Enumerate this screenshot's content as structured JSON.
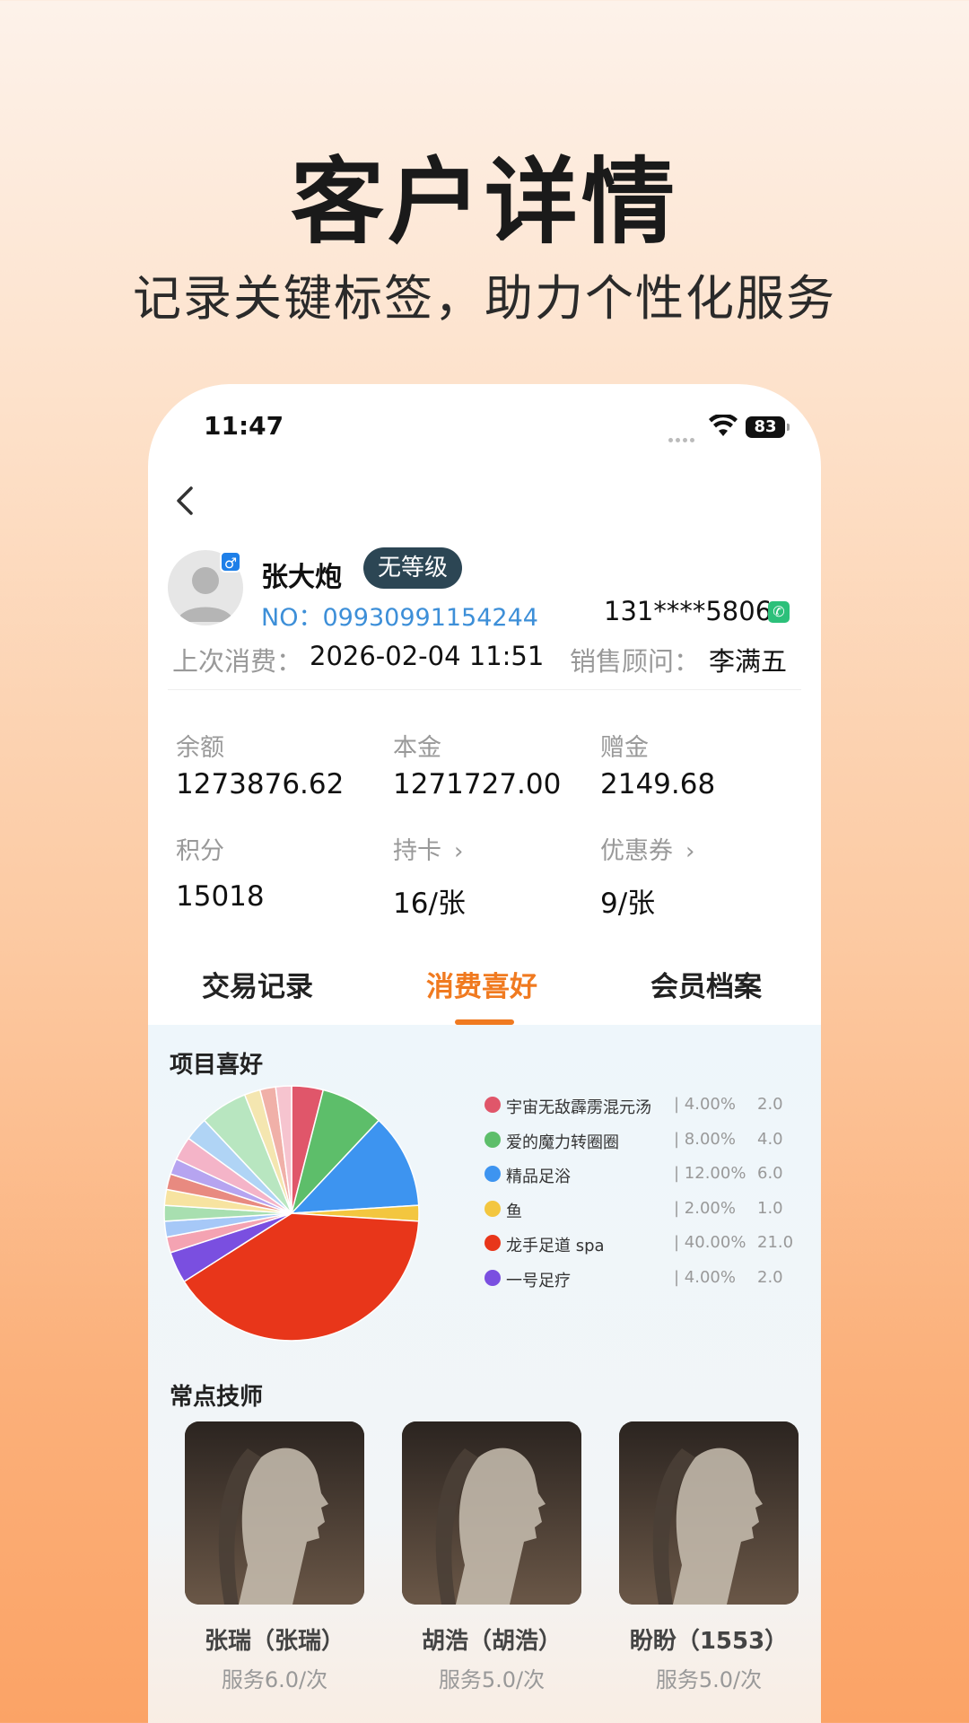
{
  "promo": {
    "title": "客户详情",
    "subtitle": "记录关键标签，助力个性化服务"
  },
  "status_bar": {
    "time": "11:47",
    "battery": "83"
  },
  "customer": {
    "name": "张大炮",
    "level": "无等级",
    "no": "NO：09930991154244",
    "phone": "131****5806",
    "last_consume_label": "上次消费：",
    "last_consume_value": "2026-02-04 11:51",
    "advisor_label": "销售顾问：",
    "advisor_value": "李满五"
  },
  "stats": [
    {
      "label": "余额",
      "value": "1273876.62"
    },
    {
      "label": "本金",
      "value": "1271727.00"
    },
    {
      "label": "赠金",
      "value": "2149.68"
    },
    {
      "label": "积分",
      "value": "15018"
    },
    {
      "label": "持卡",
      "value": "16/张"
    },
    {
      "label": "优惠券",
      "value": "9/张"
    }
  ],
  "tabs": [
    {
      "label": "交易记录"
    },
    {
      "label": "消费喜好"
    },
    {
      "label": "会员档案"
    }
  ],
  "preferences": {
    "title": "项目喜好",
    "technicians_title": "常点技师"
  },
  "chart_data": {
    "type": "pie",
    "title": "项目喜好",
    "legend_position": "right",
    "slices": [
      {
        "name": "宇宙无敌霹雳混元汤",
        "percent": 4.0,
        "value": 2.0,
        "color": "#e0566a"
      },
      {
        "name": "爱的魔力转圈圈",
        "percent": 8.0,
        "value": 4.0,
        "color": "#5dbe6a"
      },
      {
        "name": "精品足浴",
        "percent": 12.0,
        "value": 6.0,
        "color": "#3d94f0"
      },
      {
        "name": "鱼",
        "percent": 2.0,
        "value": 1.0,
        "color": "#f3c63f"
      },
      {
        "name": "龙手足道 spa",
        "percent": 40.0,
        "value": 21.0,
        "color": "#e8361a"
      },
      {
        "name": "一号足疗",
        "percent": 4.0,
        "value": 2.0,
        "color": "#7a4fe0"
      }
    ],
    "legend_text": [
      {
        "name": "宇宙无敌霹雳混元汤",
        "pct": "| 4.00%",
        "cnt": "2.0"
      },
      {
        "name": "爱的魔力转圈圈",
        "pct": "| 8.00%",
        "cnt": "4.0"
      },
      {
        "name": "精品足浴",
        "pct": "| 12.00%",
        "cnt": "6.0"
      },
      {
        "name": "鱼",
        "pct": "| 2.00%",
        "cnt": "1.0"
      },
      {
        "name": "龙手足道 spa",
        "pct": "| 40.00%",
        "cnt": "21.0"
      },
      {
        "name": "一号足疗",
        "pct": "| 4.00%",
        "cnt": "2.0"
      }
    ],
    "other_slice_colors": [
      "#f4a3b2",
      "#a6c8f7",
      "#a8dfb0",
      "#f7e3a0",
      "#e88a80",
      "#b6a4f0",
      "#f4b4c8",
      "#b0d4f5",
      "#b8e6c0",
      "#f4e6b0",
      "#f0b0a8",
      "#f6c4cf"
    ],
    "other_slice_percents": [
      2.0,
      2.0,
      2.0,
      2.0,
      2.0,
      2.0,
      3.0,
      3.0,
      6.0,
      2.0,
      2.0,
      2.0
    ]
  },
  "technicians": [
    {
      "name": "张瑞（张瑞）",
      "service": "服务6.0/次"
    },
    {
      "name": "胡浩（胡浩）",
      "service": "服务5.0/次"
    },
    {
      "name": "盼盼（1553）",
      "service": "服务5.0/次"
    }
  ],
  "colors": {
    "accent": "#f07a20",
    "level_bg": "#2c4654",
    "link": "#3d8fd8"
  },
  "icons": [
    "back-icon",
    "wifi-icon",
    "battery-icon",
    "gender-male-icon",
    "phone-call-icon",
    "chevron-right-icon"
  ]
}
